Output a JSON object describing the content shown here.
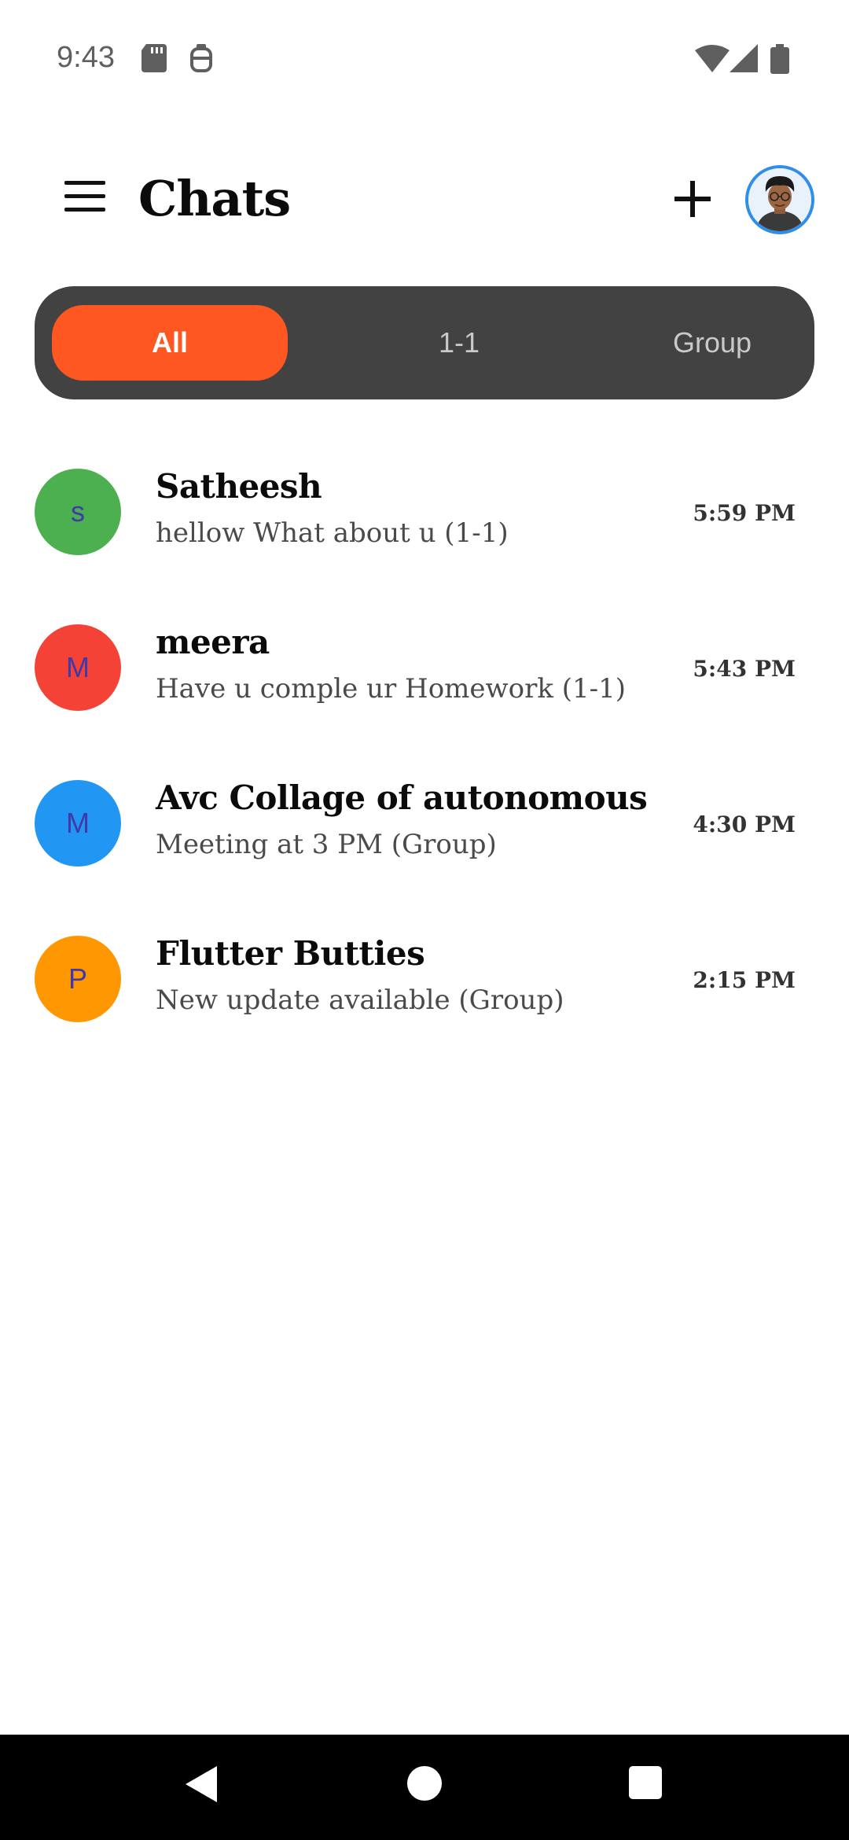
{
  "status_bar": {
    "time": "9:43",
    "icons": [
      "sd-card-icon",
      "android-bot-icon",
      "wifi-icon",
      "cell-signal-icon",
      "battery-icon"
    ]
  },
  "app_bar": {
    "title": "Chats",
    "icons": [
      "menu-icon",
      "plus-icon",
      "profile-avatar"
    ]
  },
  "tabs": [
    {
      "label": "All",
      "active": true
    },
    {
      "label": "1-1",
      "active": false
    },
    {
      "label": "Group",
      "active": false
    }
  ],
  "colors": {
    "accent": "#ff5722",
    "tab_bar_bg": "#424242",
    "avatar_green": "#4caf50",
    "avatar_red": "#f44336",
    "avatar_blue": "#2196f3",
    "avatar_orange": "#ff9800",
    "avatar_initial": "#3f3aa8"
  },
  "chats": [
    {
      "initial": "s",
      "name": "Satheesh",
      "message": "hellow What about u (1-1)",
      "time": "5:59 PM",
      "color": "#4caf50"
    },
    {
      "initial": "M",
      "name": "meera",
      "message": "Have u comple ur Homework (1-1)",
      "time": "5:43 PM",
      "color": "#f44336"
    },
    {
      "initial": "M",
      "name": "Avc Collage of autonomous",
      "message": "Meeting at 3 PM (Group)",
      "time": "4:30 PM",
      "color": "#2196f3"
    },
    {
      "initial": "P",
      "name": "Flutter Butties",
      "message": "New update available (Group)",
      "time": "2:15 PM",
      "color": "#ff9800"
    }
  ]
}
